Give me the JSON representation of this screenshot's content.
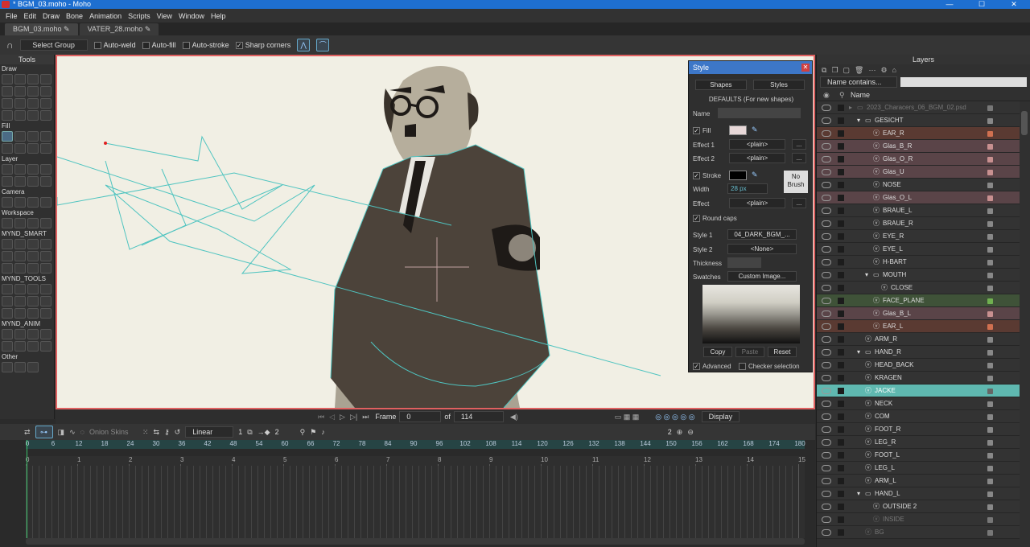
{
  "window": {
    "title": "* BGM_03.moho - Moho",
    "controls": [
      "—",
      "☐",
      "✕"
    ]
  },
  "menu": [
    "File",
    "Edit",
    "Draw",
    "Bone",
    "Animation",
    "Scripts",
    "View",
    "Window",
    "Help"
  ],
  "doc_tabs": [
    "BGM_03.moho",
    "VATER_28.moho"
  ],
  "options": {
    "select_group": "Select Group",
    "auto_weld": "Auto-weld",
    "auto_fill": "Auto-fill",
    "auto_stroke": "Auto-stroke",
    "sharp_corners": "Sharp corners"
  },
  "tools": {
    "title": "Tools",
    "sections": [
      "Draw",
      "Fill",
      "Layer",
      "Camera",
      "Workspace",
      "MYND_SMART",
      "MYND_TOOLS",
      "MYND_ANIM",
      "Other"
    ]
  },
  "style": {
    "title": "Style",
    "shapes": "Shapes",
    "styles": "Styles",
    "defaults": "DEFAULTS (For new shapes)",
    "name_label": "Name",
    "fill": "Fill",
    "fill_color": "#e8d8d8",
    "effect1_label": "Effect 1",
    "effect2_label": "Effect 2",
    "effect_value": "<plain>",
    "stroke": "Stroke",
    "width_label": "Width",
    "width_value": "28 px",
    "effect_label": "Effect",
    "no_brush": "No Brush",
    "round_caps": "Round caps",
    "style1_label": "Style 1",
    "style1_value": "04_DARK_BGM_...",
    "style2_label": "Style 2",
    "style2_value": "<None>",
    "thickness_label": "Thickness",
    "swatches_label": "Swatches",
    "swatches_value": "Custom Image...",
    "copy": "Copy",
    "paste": "Paste",
    "reset": "Reset",
    "advanced": "Advanced",
    "checker": "Checker selection",
    "more": "..."
  },
  "transport": {
    "frame_label": "Frame",
    "frame_value": "0",
    "of_label": "of",
    "total": "114",
    "display": "Display"
  },
  "timeline": {
    "onion": "Onion Skins",
    "interp": "Linear",
    "interp_num": "1",
    "keys_num": "2",
    "zoom_num": "2",
    "frame_ticks": [
      "0",
      "6",
      "12",
      "18",
      "24",
      "30",
      "36",
      "42",
      "48",
      "54",
      "60",
      "66",
      "72",
      "78",
      "84",
      "90",
      "96",
      "102",
      "108",
      "114",
      "120",
      "126",
      "132",
      "138",
      "144",
      "150",
      "156",
      "162",
      "168",
      "174",
      "180"
    ],
    "second_ticks": [
      "0",
      "1",
      "2",
      "3",
      "4",
      "5",
      "6",
      "7",
      "8",
      "9",
      "10",
      "11",
      "12",
      "13",
      "14",
      "15"
    ]
  },
  "layers": {
    "title": "Layers",
    "filter": "Name contains...",
    "col_name": "Name",
    "items": [
      {
        "name": "2023_Characers_06_BGM_02.psd",
        "indent": 0,
        "type": "folder",
        "bg": "#333333",
        "dot": "#777777",
        "dim": true
      },
      {
        "name": "GESICHT",
        "indent": 1,
        "type": "folder",
        "bg": "#333333",
        "dot": "#888888"
      },
      {
        "name": "EAR_R",
        "indent": 2,
        "type": "vector",
        "bg": "#5a3a32",
        "dot": "#d07050"
      },
      {
        "name": "Glas_B_R",
        "indent": 2,
        "type": "vector",
        "bg": "#5a4448",
        "dot": "#c89090"
      },
      {
        "name": "Glas_O_R",
        "indent": 2,
        "type": "vector",
        "bg": "#5a4448",
        "dot": "#c89090"
      },
      {
        "name": "Glas_U",
        "indent": 2,
        "type": "vector",
        "bg": "#5a4448",
        "dot": "#c89090"
      },
      {
        "name": "NOSE",
        "indent": 2,
        "type": "vector",
        "bg": "#333333",
        "dot": "#888888"
      },
      {
        "name": "Glas_O_L",
        "indent": 2,
        "type": "vector",
        "bg": "#5a4448",
        "dot": "#c89090"
      },
      {
        "name": "BRAUE_L",
        "indent": 2,
        "type": "vector",
        "bg": "#333333",
        "dot": "#888888"
      },
      {
        "name": "BRAUE_R",
        "indent": 2,
        "type": "vector",
        "bg": "#333333",
        "dot": "#888888"
      },
      {
        "name": "EYE_R",
        "indent": 2,
        "type": "vector",
        "bg": "#333333",
        "dot": "#888888"
      },
      {
        "name": "EYE_L",
        "indent": 2,
        "type": "vector",
        "bg": "#333333",
        "dot": "#888888"
      },
      {
        "name": "H-BART",
        "indent": 2,
        "type": "vector",
        "bg": "#333333",
        "dot": "#888888"
      },
      {
        "name": "MOUTH",
        "indent": 2,
        "type": "folder",
        "bg": "#333333",
        "dot": "#888888"
      },
      {
        "name": "CLOSE",
        "indent": 3,
        "type": "vector",
        "bg": "#333333",
        "dot": "#888888"
      },
      {
        "name": "FACE_PLANE",
        "indent": 2,
        "type": "vector",
        "bg": "#3f5238",
        "dot": "#70b050"
      },
      {
        "name": "Glas_B_L",
        "indent": 2,
        "type": "vector",
        "bg": "#5a4448",
        "dot": "#c89090"
      },
      {
        "name": "EAR_L",
        "indent": 2,
        "type": "vector",
        "bg": "#5a3a32",
        "dot": "#d07050"
      },
      {
        "name": "ARM_R",
        "indent": 1,
        "type": "vector",
        "bg": "#333333",
        "dot": "#888888"
      },
      {
        "name": "HAND_R",
        "indent": 1,
        "type": "folder",
        "bg": "#333333",
        "dot": "#888888"
      },
      {
        "name": "HEAD_BACK",
        "indent": 1,
        "type": "vector",
        "bg": "#333333",
        "dot": "#888888"
      },
      {
        "name": "KRAGEN",
        "indent": 1,
        "type": "vector",
        "bg": "#333333",
        "dot": "#888888"
      },
      {
        "name": "JACKE",
        "indent": 1,
        "type": "vector",
        "bg": "#5fb8b0",
        "dot": "#666666",
        "selected": true
      },
      {
        "name": "NECK",
        "indent": 1,
        "type": "vector",
        "bg": "#333333",
        "dot": "#888888"
      },
      {
        "name": "COM",
        "indent": 1,
        "type": "vector",
        "bg": "#333333",
        "dot": "#888888"
      },
      {
        "name": "FOOT_R",
        "indent": 1,
        "type": "vector",
        "bg": "#333333",
        "dot": "#888888"
      },
      {
        "name": "LEG_R",
        "indent": 1,
        "type": "vector",
        "bg": "#333333",
        "dot": "#888888"
      },
      {
        "name": "FOOT_L",
        "indent": 1,
        "type": "vector",
        "bg": "#333333",
        "dot": "#888888"
      },
      {
        "name": "LEG_L",
        "indent": 1,
        "type": "vector",
        "bg": "#333333",
        "dot": "#888888"
      },
      {
        "name": "ARM_L",
        "indent": 1,
        "type": "vector",
        "bg": "#333333",
        "dot": "#888888"
      },
      {
        "name": "HAND_L",
        "indent": 1,
        "type": "folder",
        "bg": "#333333",
        "dot": "#888888"
      },
      {
        "name": "OUTSIDE 2",
        "indent": 2,
        "type": "vector",
        "bg": "#333333",
        "dot": "#888888"
      },
      {
        "name": "INSIDE",
        "indent": 2,
        "type": "vector",
        "bg": "#333333",
        "dot": "#777777",
        "dim": true
      },
      {
        "name": "BG",
        "indent": 1,
        "type": "vector",
        "bg": "#333333",
        "dot": "#777777",
        "dim": true
      }
    ]
  }
}
